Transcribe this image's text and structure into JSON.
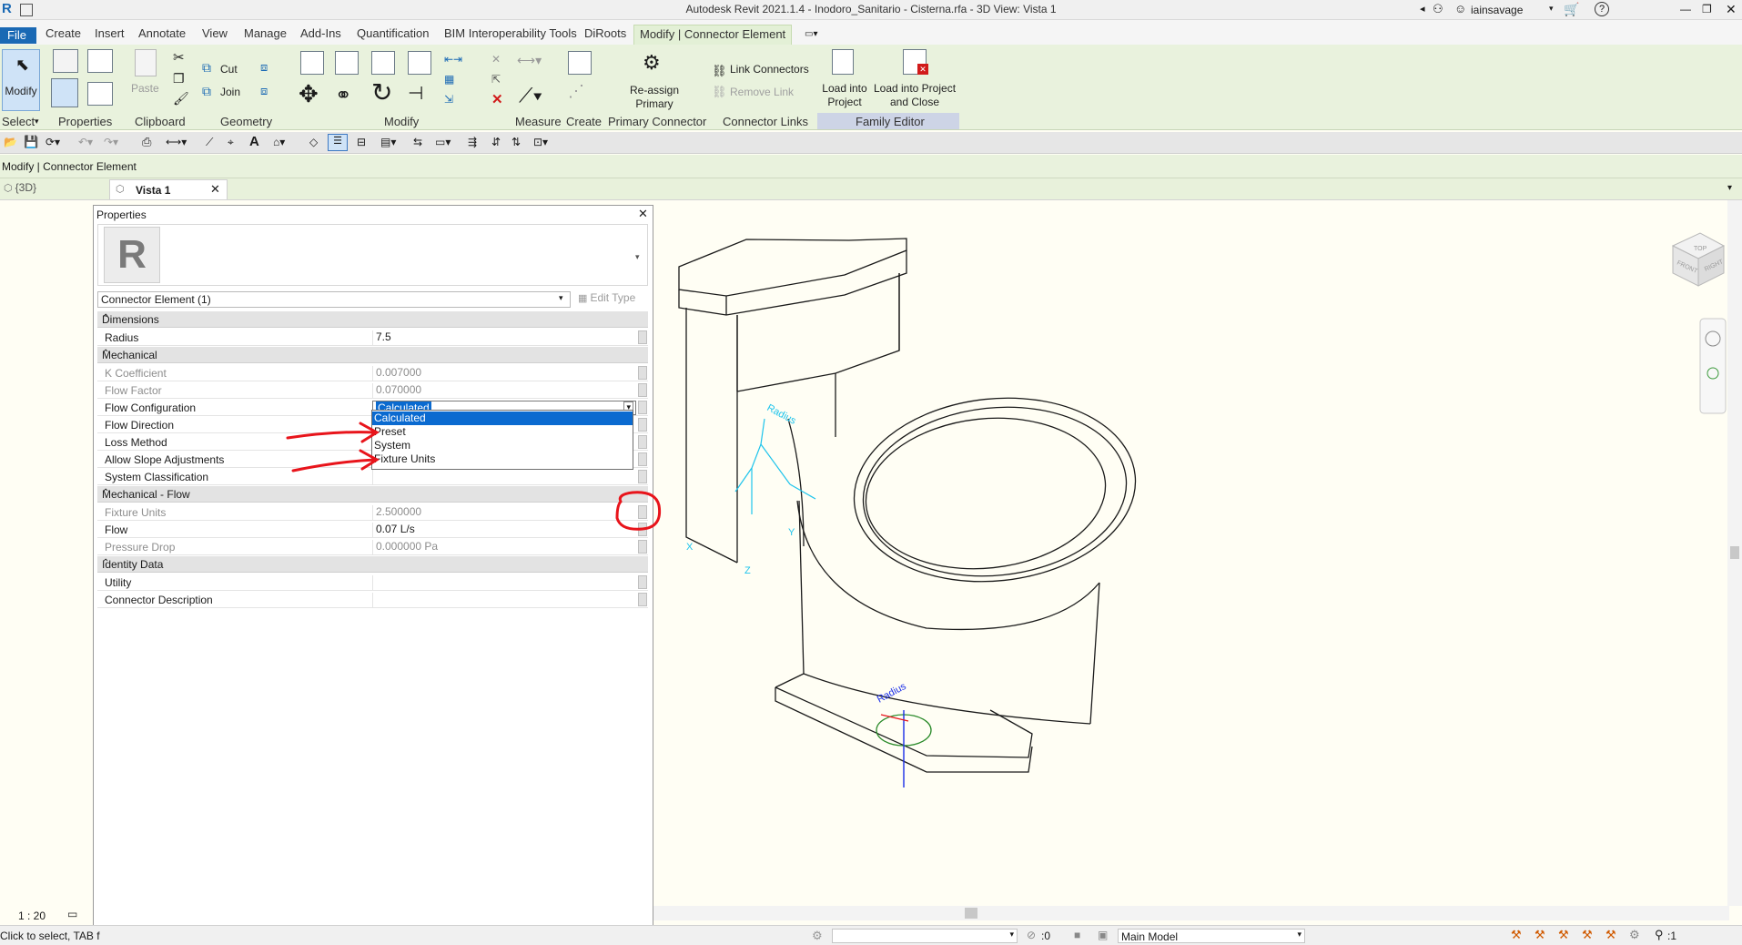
{
  "window": {
    "title": "Autodesk Revit 2021.1.4 - Inodoro_Sanitario - Cisterna.rfa - 3D View: Vista 1",
    "user": "iainsavage"
  },
  "tabs": {
    "file": "File",
    "items": [
      "Create",
      "Insert",
      "Annotate",
      "View",
      "Manage",
      "Add-Ins",
      "Quantification",
      "BIM Interoperability Tools",
      "DiRoots"
    ],
    "active": "Modify | Connector Element"
  },
  "ribbon": {
    "select": {
      "modify": "Modify",
      "label": "Select"
    },
    "properties": {
      "label": "Properties"
    },
    "clipboard": {
      "paste": "Paste",
      "label": "Clipboard"
    },
    "geometry": {
      "cut": "Cut",
      "join": "Join",
      "label": "Geometry"
    },
    "modify": {
      "label": "Modify"
    },
    "measure": {
      "label": "Measure"
    },
    "create": {
      "label": "Create"
    },
    "primary_connector": {
      "button": "Re-assign Primary",
      "label": "Primary Connector"
    },
    "connector_links": {
      "link": "Link Connectors",
      "remove": "Remove Link",
      "label": "Connector Links"
    },
    "family_editor": {
      "load": "Load into Project",
      "load_close": "Load into Project and Close",
      "label": "Family Editor"
    }
  },
  "options_bar": {
    "text": "Modify | Connector Element"
  },
  "view_tabs": [
    {
      "label": "{3D}"
    },
    {
      "label": "Vista 1"
    }
  ],
  "properties": {
    "title": "Properties",
    "type_selector": "Connector Element (1)",
    "edit_type": "Edit Type",
    "sections": [
      {
        "name": "Dimensions",
        "rows": [
          {
            "name": "Radius",
            "value": "7.5",
            "enabled": true
          }
        ]
      },
      {
        "name": "Mechanical",
        "rows": [
          {
            "name": "K Coefficient",
            "value": "0.007000",
            "enabled": false
          },
          {
            "name": "Flow Factor",
            "value": "0.070000",
            "enabled": false
          },
          {
            "name": "Flow Configuration",
            "value": "Calculated",
            "enabled": true
          },
          {
            "name": "Flow Direction",
            "value": "",
            "enabled": true
          },
          {
            "name": "Loss Method",
            "value": "",
            "enabled": true
          },
          {
            "name": "Allow Slope Adjustments",
            "value": "",
            "enabled": true
          },
          {
            "name": "System Classification",
            "value": "",
            "enabled": true
          }
        ]
      },
      {
        "name": "Mechanical - Flow",
        "rows": [
          {
            "name": "Fixture Units",
            "value": "2.500000",
            "enabled": false
          },
          {
            "name": "Flow",
            "value": "0.07 L/s",
            "enabled": true
          },
          {
            "name": "Pressure Drop",
            "value": "0.000000 Pa",
            "enabled": false
          }
        ]
      },
      {
        "name": "Identity Data",
        "rows": [
          {
            "name": "Utility",
            "value": "",
            "enabled": true
          },
          {
            "name": "Connector Description",
            "value": "",
            "enabled": true
          }
        ]
      }
    ],
    "dropdown_options": [
      "Calculated",
      "Preset",
      "System",
      "Fixture Units"
    ],
    "dropdown_selected": "Calculated"
  },
  "viewport": {
    "radius_label_1": "Radius",
    "radius_label_2": "Radius",
    "axis_x": "X",
    "axis_y": "Y",
    "axis_z": "Z",
    "viewcube": {
      "top": "TOP",
      "front": "FRONT",
      "right": "RIGHT"
    }
  },
  "status": {
    "scale": "1 : 20",
    "message": "Click to select, TAB f",
    "sel_count": ":0",
    "model": "Main Model",
    "filter": ":1"
  },
  "colors": {
    "ribbon_bg": "#e9f2dd",
    "file_tab": "#1a69b4",
    "selection": "#0a6ad0",
    "annotation_red": "#e8141b",
    "connector_cyan": "#1ec4ec"
  }
}
